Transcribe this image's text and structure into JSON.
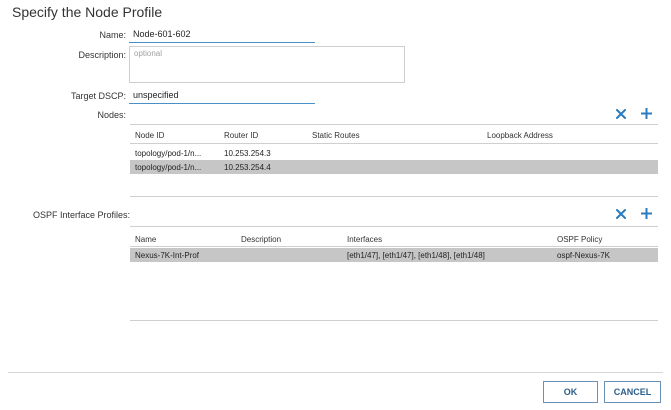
{
  "dialog": {
    "title": "Specify the Node Profile"
  },
  "form": {
    "name_label": "Name:",
    "name_value": "Node-601-602",
    "description_label": "Description:",
    "description_placeholder": "optional",
    "dscp_label": "Target DSCP:",
    "dscp_value": "unspecified",
    "nodes_label": "Nodes:",
    "ospf_label": "OSPF Interface Profiles:"
  },
  "nodes_table": {
    "columns": [
      "Node ID",
      "Router ID",
      "Static Routes",
      "Loopback Address"
    ],
    "rows": [
      [
        "topology/pod-1/n...",
        "10.253.254.3",
        "",
        ""
      ],
      [
        "topology/pod-1/n...",
        "10.253.254.4",
        "",
        ""
      ]
    ],
    "selected_row": 1
  },
  "ospf_table": {
    "columns": [
      "Name",
      "Description",
      "Interfaces",
      "OSPF Policy"
    ],
    "rows": [
      [
        "Nexus-7K-Int-Prof",
        "",
        "[eth1/47], [eth1/47], [eth1/48], [eth1/48]",
        "ospf-Nexus-7K"
      ]
    ],
    "selected_row": 0
  },
  "icons": {
    "delete": "x-icon",
    "add": "plus-icon"
  },
  "colors": {
    "accent": "#2a7bbf",
    "selected_row": "#c6c6c6"
  },
  "footer": {
    "ok_label": "OK",
    "cancel_label": "CANCEL"
  }
}
